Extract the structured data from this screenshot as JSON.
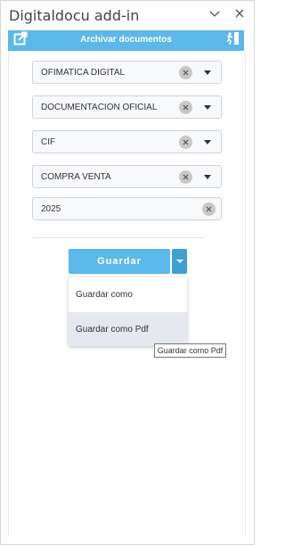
{
  "window": {
    "title": "Digitaldocu add-in",
    "chevron_icon": "chevron-down-icon",
    "close_icon": "close-icon"
  },
  "header": {
    "title": "Archivar documentos",
    "background": "#5cb8ea",
    "left_icon": "open-external-icon",
    "right_icon": "exit-icon"
  },
  "fields": [
    {
      "value": "OFIMATICA DIGITAL",
      "has_dropdown": true
    },
    {
      "value": "DOCUMENTACION OFICIAL",
      "has_dropdown": true
    },
    {
      "value": "CIF",
      "has_dropdown": true
    },
    {
      "value": "COMPRA VENTA",
      "has_dropdown": true
    },
    {
      "value": "2025",
      "has_dropdown": false
    }
  ],
  "actions": {
    "save_label": "Guardar",
    "split_icon": "chevron-down-icon",
    "menu": [
      {
        "label": "Guardar como"
      },
      {
        "label": "Guardar como Pdf",
        "hovered": true
      }
    ],
    "tooltip": "Guardar como Pdf"
  },
  "colors": {
    "accent": "#5cb8ea",
    "accent_dark": "#3f9fd3",
    "menu_hover": "#e6e8ef"
  }
}
